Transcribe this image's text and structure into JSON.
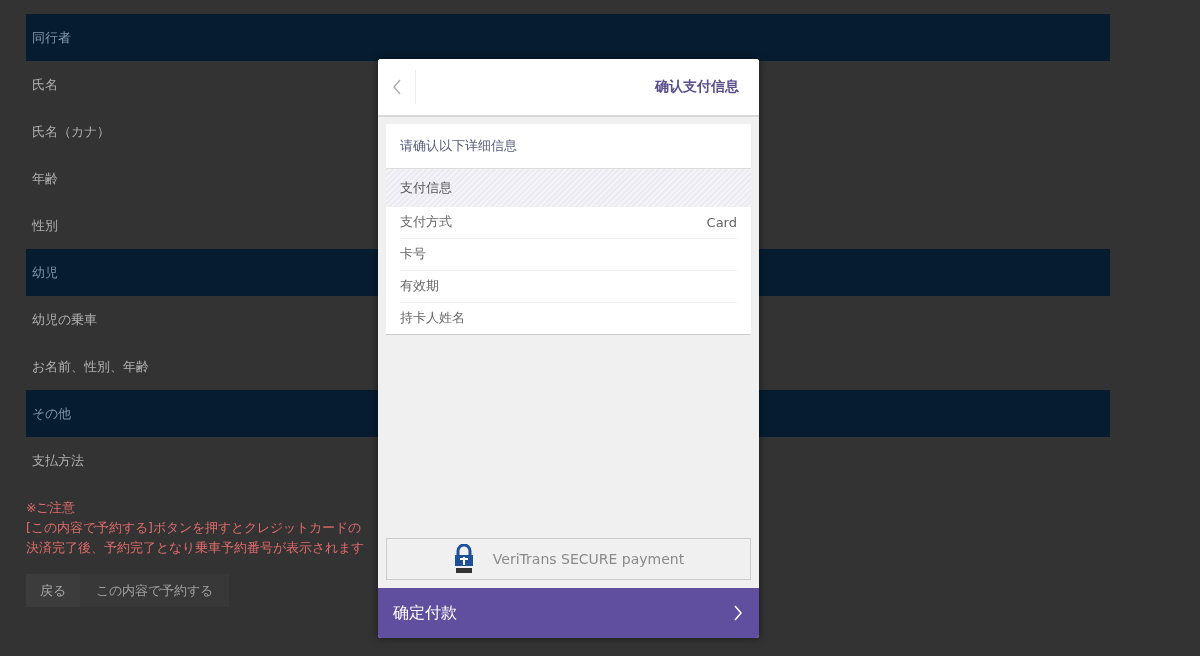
{
  "page": {
    "sections": [
      {
        "title": "同行者",
        "rows": [
          "氏名",
          "氏名（カナ）",
          "年齢",
          "性別"
        ]
      },
      {
        "title": "幼児",
        "rows": [
          "幼児の乗車",
          "お名前、性別、年齢"
        ]
      },
      {
        "title": "その他",
        "rows": [
          "支払方法"
        ]
      }
    ],
    "notice": {
      "title": "※ご注意",
      "lines": [
        "[この内容で予約する]ボタンを押すとクレジットカードの",
        "決済完了後、予約完了となり乗車予約番号が表示されます"
      ]
    },
    "buttons": [
      {
        "label": "戻る",
        "kind": "back"
      },
      {
        "label": "この内容で予約する",
        "kind": "submit"
      }
    ]
  },
  "dialog": {
    "title": "确认支付信息",
    "prompt": "请确认以下详细信息",
    "section_title": "支付信息",
    "fields": [
      {
        "label": "支付方式",
        "value": "Card"
      },
      {
        "label": "卡号"
      },
      {
        "label": "有效期"
      },
      {
        "label": "持卡人姓名"
      }
    ],
    "secure_label": "VeriTrans SECURE payment",
    "confirm_button": "确定付款"
  }
}
